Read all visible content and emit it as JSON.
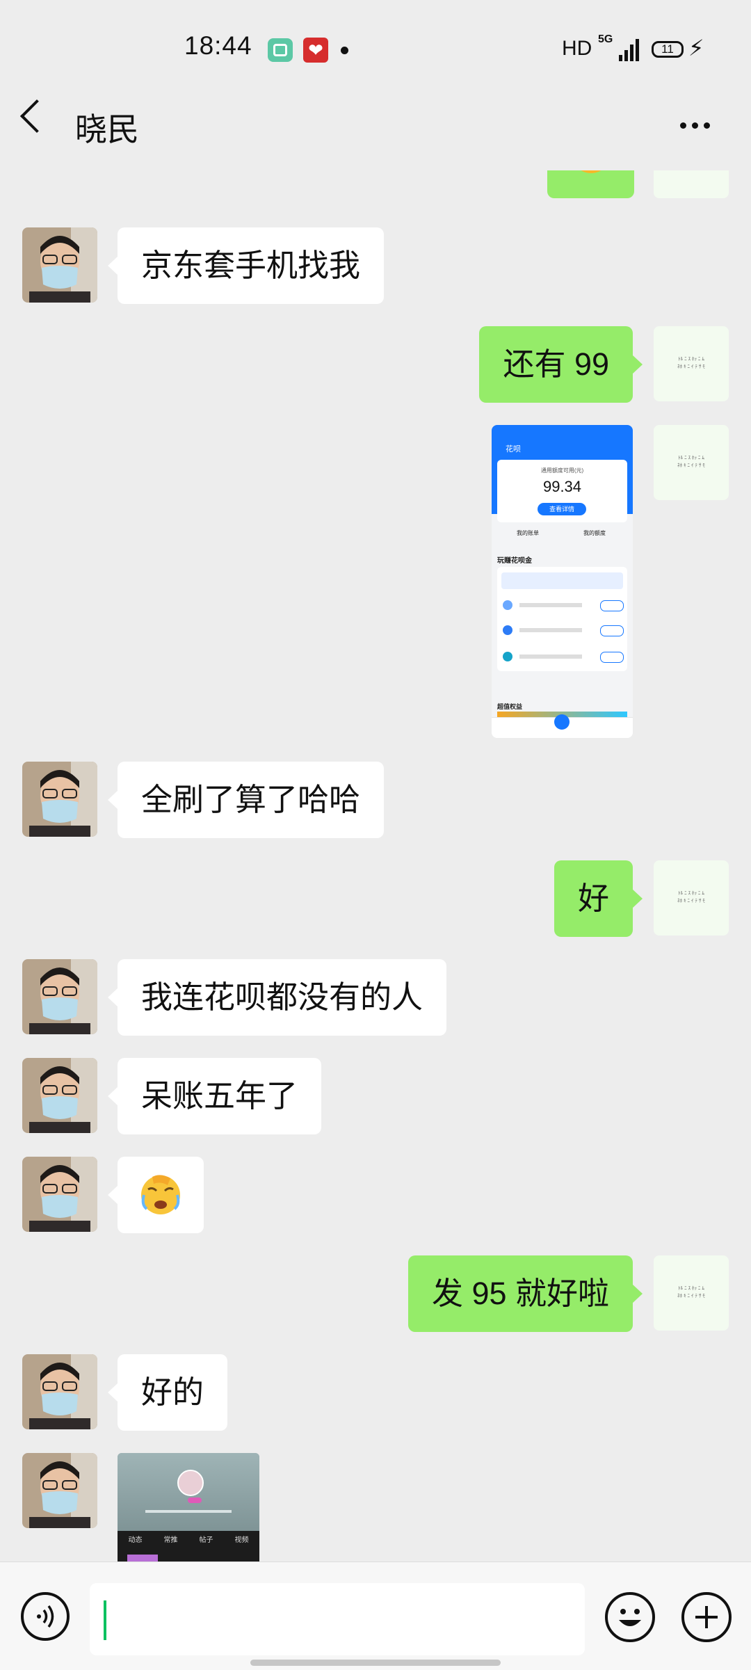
{
  "status_bar": {
    "time": "18:44",
    "quality": "HD",
    "network": "5G",
    "battery_level": "11",
    "notification_icons": [
      "gallery-icon",
      "heart-app-icon"
    ]
  },
  "header": {
    "contact_name": "晓民"
  },
  "chat": {
    "messages": [
      {
        "side": "right",
        "type": "emoji",
        "content": "emoji-partial"
      },
      {
        "side": "left",
        "type": "text",
        "text": "京东套手机找我"
      },
      {
        "side": "right",
        "type": "text",
        "text": "还有 99"
      },
      {
        "side": "right",
        "type": "image",
        "content": {
          "app_title": "花呗",
          "limit_label": "通用额度可用(元)",
          "amount": "99.34",
          "detail_button": "查看详情",
          "my_bill": "我的账单",
          "my_limit": "我的额度",
          "section_title": "玩赚花呗金",
          "benefits_title": "超值权益"
        }
      },
      {
        "side": "left",
        "type": "text",
        "text": "全刷了算了哈哈"
      },
      {
        "side": "right",
        "type": "text",
        "text": "好"
      },
      {
        "side": "left",
        "type": "text",
        "text": "我连花呗都没有的人"
      },
      {
        "side": "left",
        "type": "text",
        "text": "呆账五年了"
      },
      {
        "side": "left",
        "type": "emoji",
        "content": "facepalm-crying-emoji"
      },
      {
        "side": "right",
        "type": "text",
        "text": "发 95 就好啦"
      },
      {
        "side": "left",
        "type": "text",
        "text": "好的"
      },
      {
        "side": "left",
        "type": "image",
        "content": {
          "tabs": [
            "动态",
            "常推",
            "帖子",
            "视频"
          ]
        }
      }
    ]
  },
  "input_bar": {
    "value": "",
    "icons": [
      "voice-icon",
      "emoji-icon",
      "plus-icon"
    ]
  },
  "colors": {
    "background": "#ededed",
    "sent_bubble": "#95ec69",
    "received_bubble": "#ffffff",
    "cursor": "#07c160"
  }
}
